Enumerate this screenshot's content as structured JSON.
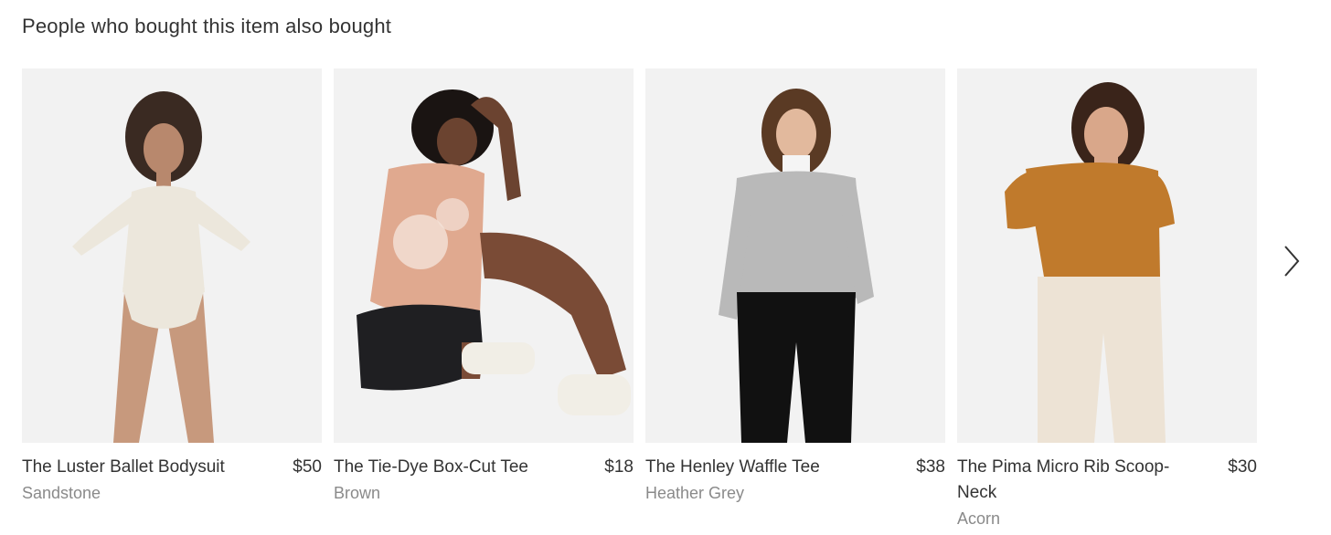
{
  "section": {
    "title": "People who bought this item also bought"
  },
  "products": [
    {
      "name": "The Luster Ballet Bodysuit",
      "price": "$50",
      "color": "Sandstone",
      "top_color": "#ece7dc",
      "bottom_color": "#d7b49a"
    },
    {
      "name": "The Tie-Dye Box-Cut Tee",
      "price": "$18",
      "color": "Brown",
      "top_color": "#e0a98f",
      "bottom_color": "#1f1f22"
    },
    {
      "name": "The Henley Waffle Tee",
      "price": "$38",
      "color": "Heather Grey",
      "top_color": "#b9b9b9",
      "bottom_color": "#111111"
    },
    {
      "name": "The Pima Micro Rib Scoop-Neck",
      "price": "$30",
      "color": "Acorn",
      "top_color": "#c07a2c",
      "bottom_color": "#ede3d5"
    }
  ],
  "nav": {
    "next_icon": "chevron-right-icon"
  }
}
